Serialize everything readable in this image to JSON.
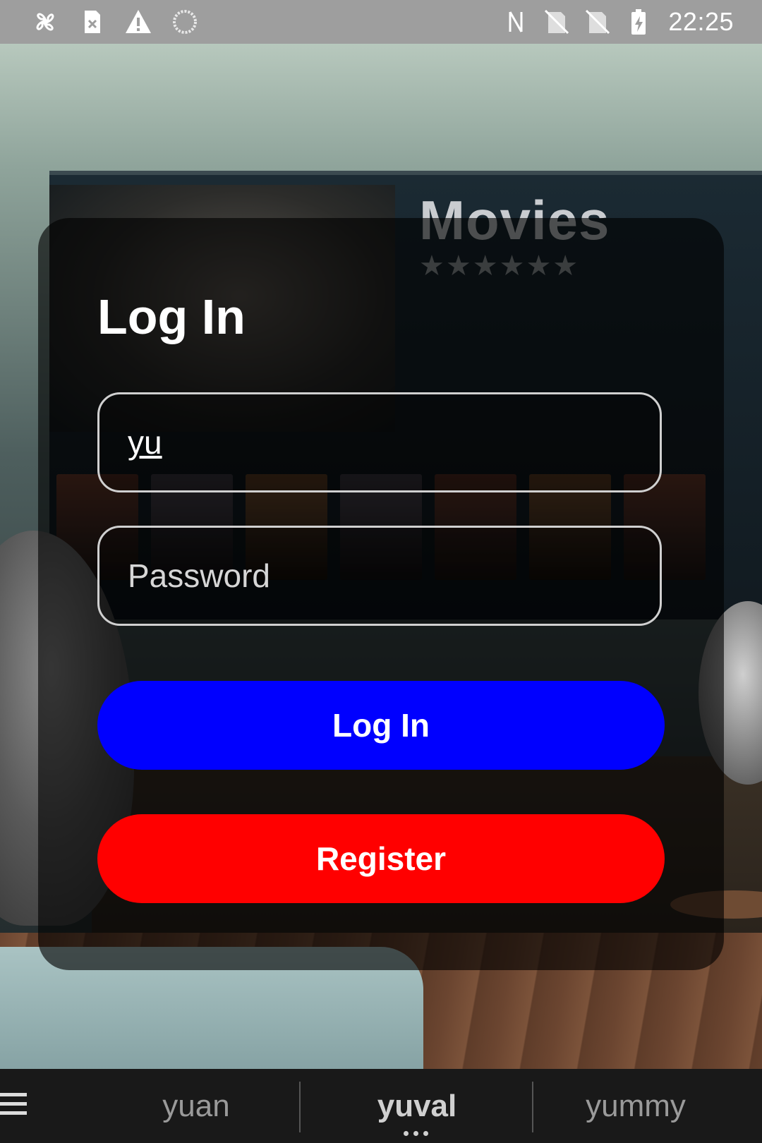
{
  "status_bar": {
    "time": "22:25",
    "left_icons": [
      "fan-icon",
      "sim-error-icon",
      "warning-icon",
      "loading-icon"
    ],
    "right_icons": [
      "nfc-icon",
      "no-sim-icon",
      "no-sim-icon",
      "battery-charging-icon"
    ]
  },
  "background": {
    "title": "Movies",
    "stars": "★★★★★★"
  },
  "login": {
    "title": "Log In",
    "username_value": "yu",
    "password_placeholder": "Password",
    "login_button_label": "Log In",
    "register_button_label": "Register",
    "colors": {
      "login_button": "#0000ff",
      "register_button": "#ff0000"
    }
  },
  "suggestions": {
    "items": [
      "yuan",
      "yuval",
      "yummy"
    ],
    "selected_index": 1
  }
}
